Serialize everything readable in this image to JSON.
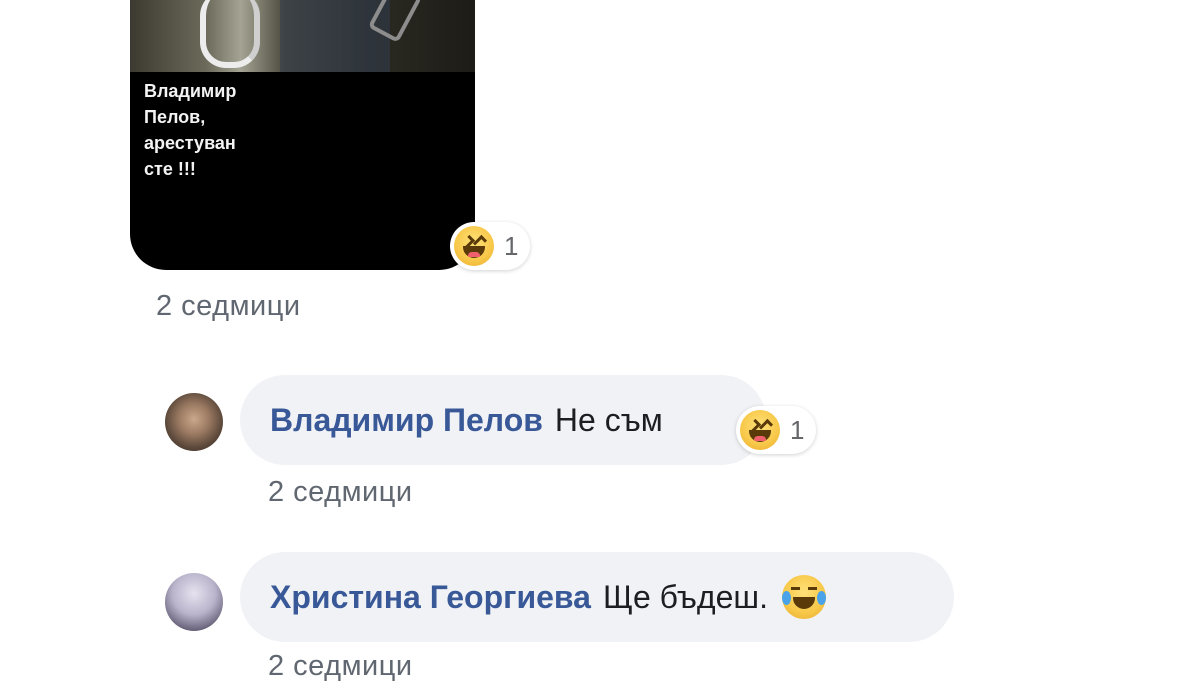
{
  "image_comment": {
    "caption": "Владимир\nПелов,\nарестуван\nсте !!!",
    "reaction_count": "1",
    "reaction_icon": "haha-icon",
    "timestamp": "2 седмици"
  },
  "comments": [
    {
      "author": "Владимир Пелов",
      "text": "Не съм",
      "reaction_icon": "haha-icon",
      "reaction_count": "1",
      "timestamp": "2 седмици"
    },
    {
      "author": "Христина Георгиева",
      "text": "Ще бъдеш.",
      "emoji_icon": "tears-of-joy-icon",
      "timestamp": "2 седмици"
    }
  ],
  "colors": {
    "author": "#385898",
    "bubble": "#f0f2f5",
    "timestamp": "#606770"
  }
}
